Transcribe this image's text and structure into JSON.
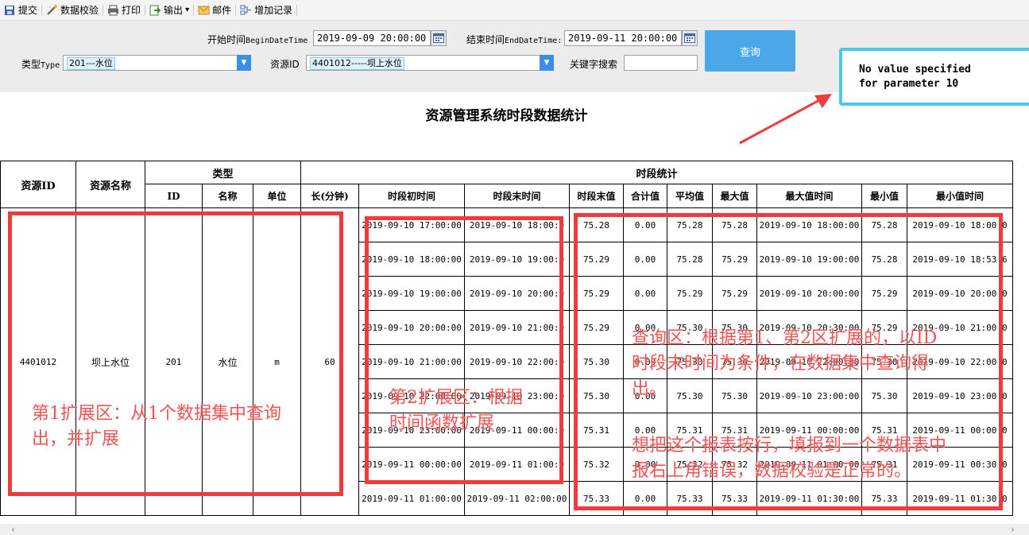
{
  "toolbar": {
    "items": [
      {
        "label": "提交",
        "icon": "save-icon"
      },
      {
        "label": "数据校验",
        "icon": "wand-icon"
      },
      {
        "label": "打印",
        "icon": "printer-icon"
      },
      {
        "label": "输出",
        "icon": "export-icon",
        "dropdown": "▾"
      },
      {
        "label": "邮件",
        "icon": "mail-icon"
      },
      {
        "label": "增加记录",
        "icon": "add-record-icon"
      }
    ]
  },
  "query": {
    "begin_label": "开始时间",
    "begin_param": "BeginDateTime",
    "begin_value": "2019-09-09 20:00:00",
    "end_label": "结束时间",
    "end_param": "EndDateTime:",
    "end_value": "2019-09-11 20:00:00",
    "type_label": "类型",
    "type_param": "Type",
    "type_value": "201---水位",
    "resource_label": "资源ID",
    "resource_value": "4401012-----坝上水位",
    "keyword_label": "关键字搜索",
    "keyword_value": "",
    "search_button": "查询"
  },
  "report": {
    "title": "资源管理系统时段数据统计",
    "headers": {
      "resource_id": "资源ID",
      "resource_name": "资源名称",
      "type": "类型",
      "type_id": "ID",
      "type_name": "名称",
      "type_unit": "单位",
      "length": "长(分钟)",
      "period_stats": "时段统计",
      "start": "时段初时间",
      "end": "时段末时间",
      "end_value": "时段末值",
      "sum": "合计值",
      "avg": "平均值",
      "max": "最大值",
      "max_time": "最大值时间",
      "min": "最小值",
      "min_time": "最小值时间"
    },
    "group": {
      "resource_id": "4401012",
      "resource_name": "坝上水位",
      "type_id": "201",
      "type_name": "水位",
      "unit": "m",
      "length": "60"
    },
    "rows": [
      {
        "start": "2019-09-10 17:00:00",
        "end": "2019-09-10 18:00:0",
        "end_value": "75.28",
        "sum": "0.00",
        "avg": "75.28",
        "max": "75.28",
        "max_time": "2019-09-10 18:00:00",
        "min": "75.28",
        "min_time": "2019-09-10 18:00:0"
      },
      {
        "start": "2019-09-10 18:00:00",
        "end": "2019-09-10 19:00:0",
        "end_value": "75.29",
        "sum": "0.00",
        "avg": "75.28",
        "max": "75.29",
        "max_time": "2019-09-10 19:00:00",
        "min": "75.28",
        "min_time": "2019-09-10 18:53:6"
      },
      {
        "start": "2019-09-10 19:00:00",
        "end": "2019-09-10 20:00:0",
        "end_value": "75.29",
        "sum": "0.00",
        "avg": "75.29",
        "max": "75.29",
        "max_time": "2019-09-10 20:00:00",
        "min": "75.29",
        "min_time": "2019-09-10 20:00:0"
      },
      {
        "start": "2019-09-10 20:00:00",
        "end": "2019-09-10 21:00:0",
        "end_value": "75.29",
        "sum": "0.00",
        "avg": "75.30",
        "max": "75.30",
        "max_time": "2019-09-10 20:30:00",
        "min": "75.29",
        "min_time": "2019-09-10 21:00:0"
      },
      {
        "start": "2019-09-10 21:00:00",
        "end": "2019-09-10 22:00:0",
        "end_value": "75.30",
        "sum": "0.00",
        "avg": "75.30",
        "max": "75.30",
        "max_time": "2019-09-10 22:00:00",
        "min": "75.30",
        "min_time": "2019-09-10 22:00:0"
      },
      {
        "start": "2019-09-10 22:00:00",
        "end": "2019-09-10 23:00:0",
        "end_value": "75.30",
        "sum": "0.00",
        "avg": "75.30",
        "max": "75.30",
        "max_time": "2019-09-10 23:00:00",
        "min": "75.30",
        "min_time": "2019-09-10 23:00:0"
      },
      {
        "start": "2019-09-10 23:00:00",
        "end": "2019-09-11 00:00:0",
        "end_value": "75.31",
        "sum": "0.00",
        "avg": "75.31",
        "max": "75.31",
        "max_time": "2019-09-11 00:00:00",
        "min": "75.31",
        "min_time": "2019-09-11 00:00:0"
      },
      {
        "start": "2019-09-11 00:00:00",
        "end": "2019-09-11 01:00:0",
        "end_value": "75.32",
        "sum": "0.00",
        "avg": "75.32",
        "max": "75.32",
        "max_time": "2019-09-11 01:00:00",
        "min": "75.31",
        "min_time": "2019-09-11 00:30:0"
      },
      {
        "start": "2019-09-11 01:00:00",
        "end": "2019-09-11 02:00:00",
        "end_value": "75.33",
        "sum": "0.00",
        "avg": "75.33",
        "max": "75.33",
        "max_time": "2019-09-11 01:30:00",
        "min": "75.33",
        "min_time": "2019-09-11 01:30:0"
      }
    ]
  },
  "error_message": {
    "line1": "No value specified",
    "line2": "for parameter 10"
  },
  "annotations": {
    "zone1_line1": "第1扩展区：从1个数据集中查询",
    "zone1_line2": "出，并扩展",
    "zone2_line1": "第2扩展区：根据",
    "zone2_line2": "时间函数扩展",
    "query_line1": "查询区：根据第1、第2区扩展的，以ID",
    "query_line2": "时段末时间为条件，在数据集中查询得",
    "query_line3": "出。",
    "query_line4": "想把这个报表按行，填报到一个数据表中",
    "query_line5": "报右上角错误，数据校验是正常的。"
  },
  "colors": {
    "annotation_red": "#ef3b3b",
    "error_border": "#4cc7f0",
    "search_button": "#4ca7e8"
  },
  "scrollbar": {
    "left": "‹",
    "right": "›"
  }
}
